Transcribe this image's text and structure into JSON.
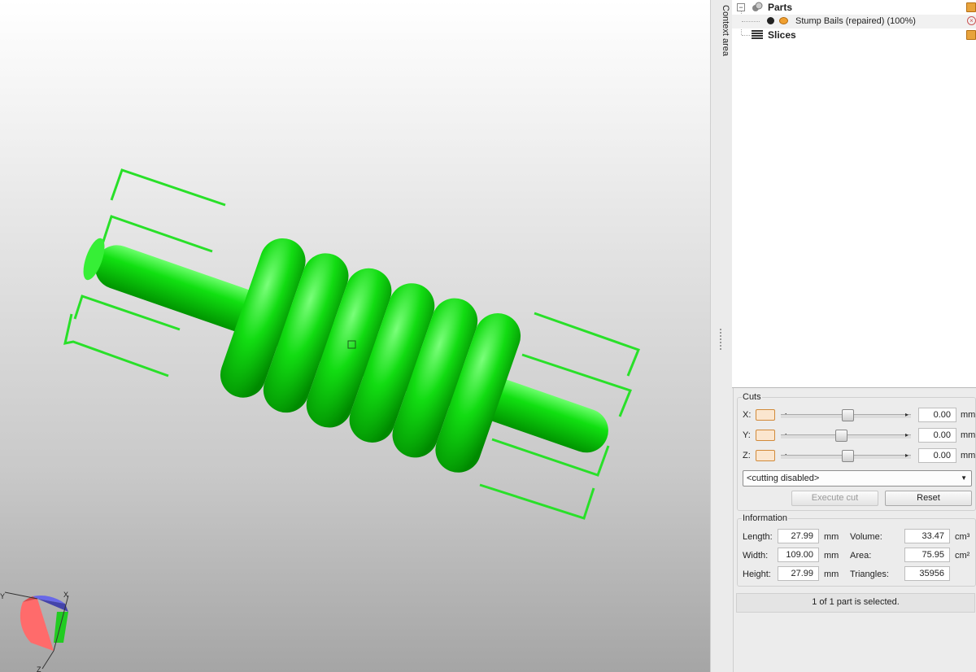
{
  "viewport": {
    "model_color": "#00d600",
    "bbox_color": "#29e029",
    "gizmo": {
      "x_label": "X",
      "y_label": "Y",
      "z_label": "Z"
    }
  },
  "context_strip": {
    "label": "Context area"
  },
  "tree": {
    "parts_label": "Parts",
    "part_item_label": "Stump Bails (repaired) (100%)",
    "slices_label": "Slices",
    "expander_symbol": "⊟"
  },
  "cuts": {
    "title": "Cuts",
    "rows": [
      {
        "axis": "X:",
        "value": "0.00",
        "unit": "mm",
        "position": 0.5
      },
      {
        "axis": "Y:",
        "value": "0.00",
        "unit": "mm",
        "position": 0.45
      },
      {
        "axis": "Z:",
        "value": "0.00",
        "unit": "mm",
        "position": 0.5
      }
    ],
    "mode_value": "<cutting disabled>",
    "execute_label": "Execute cut",
    "reset_label": "Reset"
  },
  "information": {
    "title": "Information",
    "length_label": "Length:",
    "length_value": "27.99",
    "length_unit": "mm",
    "width_label": "Width:",
    "width_value": "109.00",
    "width_unit": "mm",
    "height_label": "Height:",
    "height_value": "27.99",
    "height_unit": "mm",
    "volume_label": "Volume:",
    "volume_value": "33.47",
    "volume_unit": "cm³",
    "area_label": "Area:",
    "area_value": "75.95",
    "area_unit": "cm²",
    "triangles_label": "Triangles:",
    "triangles_value": "35956"
  },
  "status": {
    "text": "1 of 1 part is selected."
  }
}
